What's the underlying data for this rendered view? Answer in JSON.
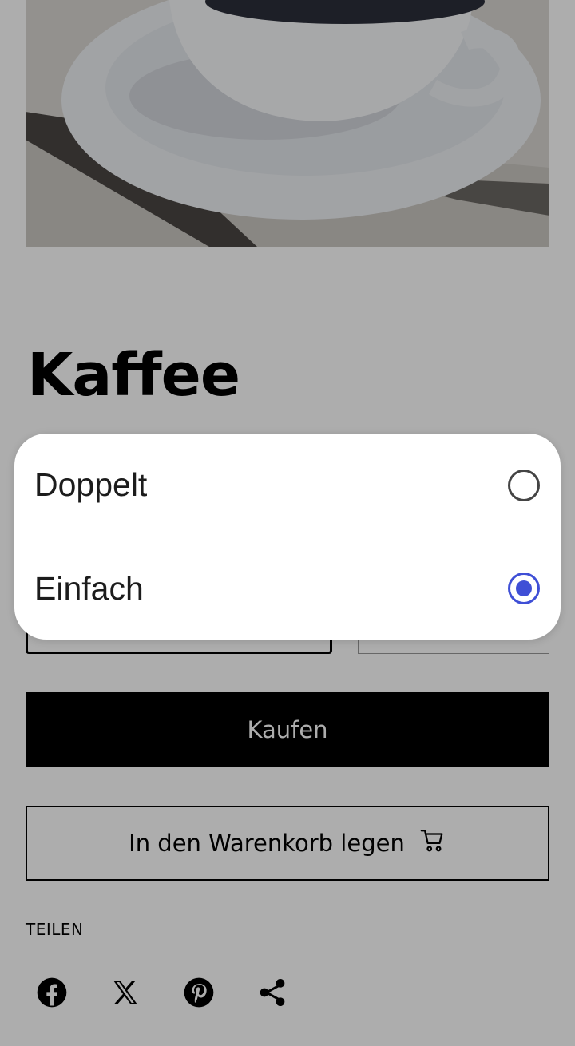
{
  "product": {
    "title": "Kaffee",
    "image_alt": "coffee-cup-photo"
  },
  "actions": {
    "buy_label": "Kaufen",
    "add_to_cart_label": "In den Warenkorb legen"
  },
  "share": {
    "label": "TEILEN",
    "icons": [
      "facebook-icon",
      "x-icon",
      "pinterest-icon",
      "share-icon"
    ]
  },
  "option_sheet": {
    "options": [
      {
        "label": "Doppelt",
        "selected": false
      },
      {
        "label": "Einfach",
        "selected": true
      }
    ],
    "accent_color": "#3f4fd6"
  }
}
